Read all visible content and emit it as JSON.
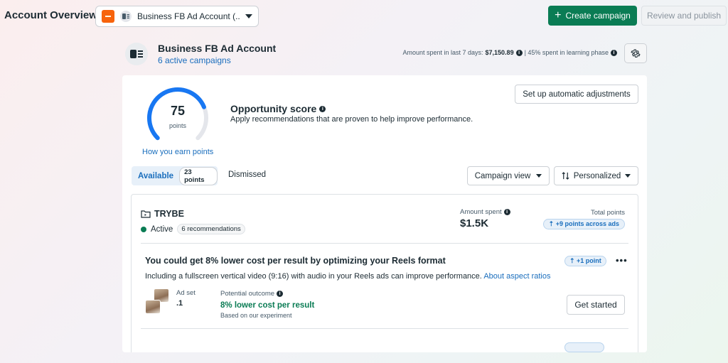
{
  "header": {
    "title": "Account Overview",
    "account_selector": "Business FB Ad Account (...",
    "create_label": "Create campaign",
    "review_label": "Review and publish"
  },
  "account": {
    "name": "Business FB Ad Account",
    "campaigns_link": "6 active campaigns",
    "spent_prefix": "Amount spent in last 7 days:",
    "spent_value": "$7,150.89",
    "learning_phase": "| 45% spent in learning phase"
  },
  "opportunity": {
    "score": "75",
    "score_fraction": 0.75,
    "unit": "points",
    "earn_link": "How you earn points",
    "title": "Opportunity score",
    "description": "Apply recommendations that are proven to help improve performance.",
    "adjust_button": "Set up automatic adjustments"
  },
  "tabs": {
    "available": "Available",
    "available_count": "23 points",
    "dismissed": "Dismissed"
  },
  "filters": {
    "view": "Campaign view",
    "sort": "Personalized"
  },
  "campaign": {
    "name": "TRYBE",
    "status": "Active",
    "recommendations": "6 recommendations",
    "amount_label": "Amount spent",
    "amount_value": "$1.5K",
    "points_label": "Total points",
    "points_badge": "+9 points across ads"
  },
  "recommendation": {
    "title": "You could get 8% lower cost per result by optimizing your Reels format",
    "description": "Including a fullscreen vertical video (9:16) with audio in your Reels ads can improve performance.",
    "link": "About aspect ratios",
    "points": "+1 point",
    "adset_label": "Ad set",
    "adset_value": ".1",
    "outcome_label": "Potential outcome",
    "outcome_value": "8% lower cost per result",
    "outcome_note": "Based on our experiment",
    "cta": "Get started"
  },
  "colors": {
    "primary": "#0a7c54",
    "link": "#1a6ebd",
    "gauge": "#1877f2"
  }
}
